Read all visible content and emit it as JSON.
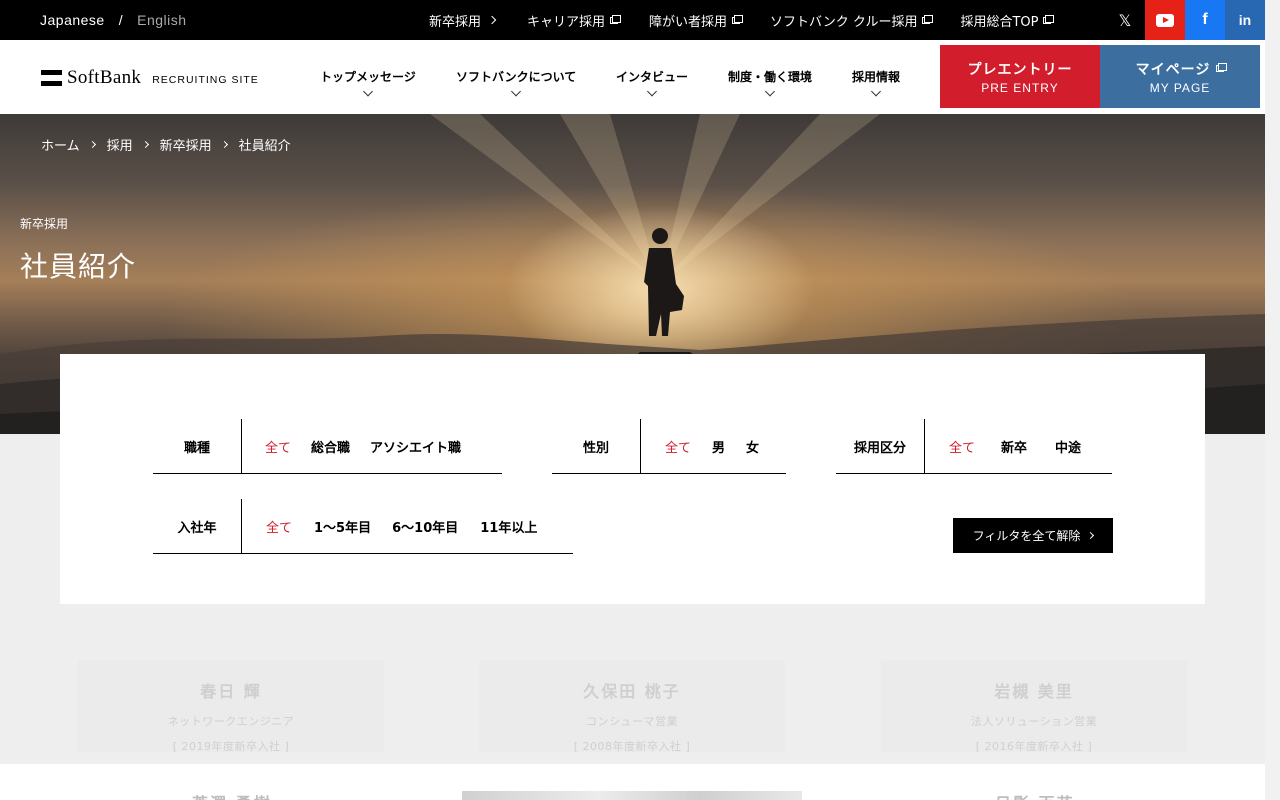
{
  "util_bar": {
    "lang_active": "Japanese",
    "lang_sep": "/",
    "lang_other": "English",
    "links": [
      {
        "label": "新卒採用",
        "icon": "chevron-right-icon"
      },
      {
        "label": "キャリア採用",
        "icon": "external-link-icon"
      },
      {
        "label": "障がい者採用",
        "icon": "external-link-icon"
      },
      {
        "label": "ソフトバンク クルー採用",
        "icon": "external-link-icon"
      },
      {
        "label": "採用総合TOP",
        "icon": "external-link-icon"
      }
    ],
    "social": {
      "x": "𝕏",
      "youtube": "youtube-icon",
      "facebook": "f",
      "linkedin": "in"
    },
    "colors": {
      "youtube": "#e62117",
      "facebook": "#1877f2",
      "linkedin": "#2867b2"
    }
  },
  "header": {
    "logo_text": "SoftBank",
    "logo_sub": "RECRUITING SITE",
    "nav": [
      "トップメッセージ",
      "ソフトバンクについて",
      "インタビュー",
      "制度・働く環境",
      "採用情報"
    ],
    "entry": {
      "label": "プレエントリー",
      "sub": "PRE ENTRY",
      "color": "#d21d2d"
    },
    "mypage": {
      "label": "マイページ",
      "sub": "MY PAGE",
      "color": "#3c6ea0"
    }
  },
  "hero": {
    "breadcrumb": [
      "ホーム",
      "採用",
      "新卒採用",
      "社員紹介"
    ],
    "category": "新卒採用",
    "title": "社員紹介"
  },
  "filters": {
    "groups": [
      {
        "label": "職種",
        "options": [
          "全て",
          "総合職",
          "アソシエイト職"
        ],
        "selected": "全て"
      },
      {
        "label": "性別",
        "options": [
          "全て",
          "男",
          "女"
        ],
        "selected": "全て"
      },
      {
        "label": "採用区分",
        "options": [
          "全て",
          "新卒",
          "中途"
        ],
        "selected": "全て"
      },
      {
        "label": "入社年",
        "options": [
          "全て",
          "1〜5年目",
          "6〜10年目",
          "11年以上"
        ],
        "selected": "全て"
      }
    ],
    "clear_label": "フィルタを全て解除",
    "accent": "#d21d2d"
  },
  "employees": [
    {
      "name": "春日 輝",
      "role": "ネットワークエンジニア",
      "year": "[ 2019年度新卒入社 ]"
    },
    {
      "name": "久保田 桃子",
      "role": "コンシューマ営業",
      "year": "[ 2008年度新卒入社 ]"
    },
    {
      "name": "岩槻 美里",
      "role": "法人ソリューション営業",
      "year": "[ 2016年度新卒入社 ]"
    }
  ],
  "employees_row2": [
    "芦澤 勇樹",
    "日影 百花"
  ]
}
